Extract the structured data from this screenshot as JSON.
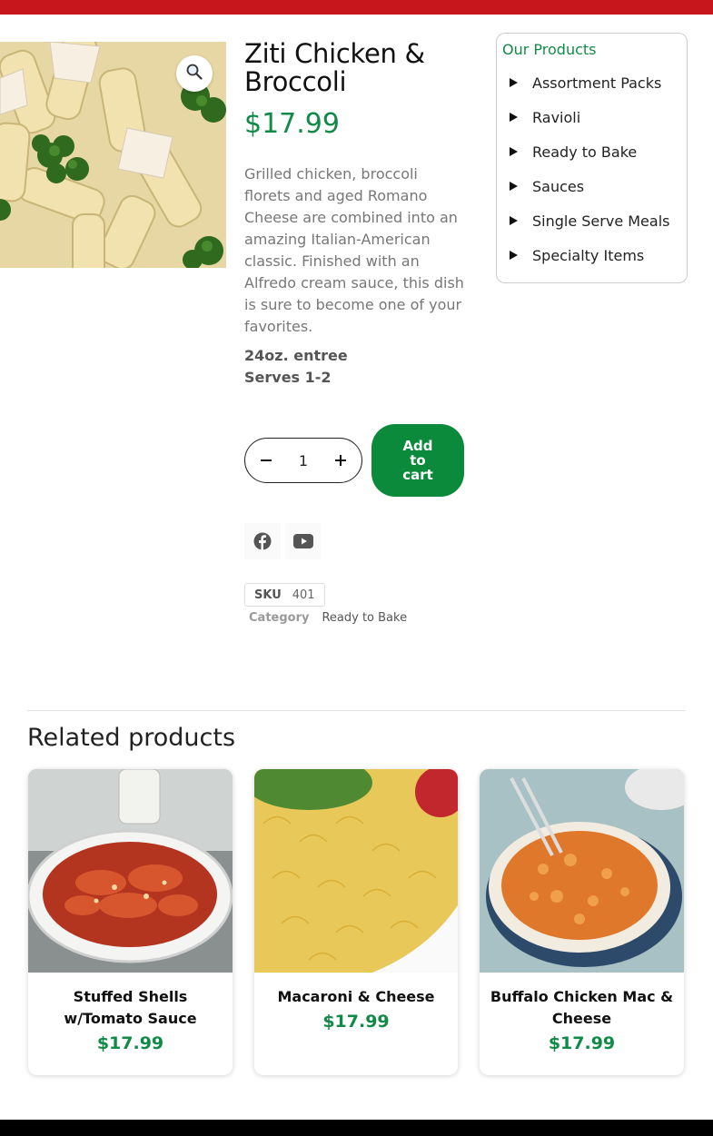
{
  "product": {
    "title": "Ziti Chicken & Broccoli",
    "price": "$17.99",
    "description": "Grilled chicken, broccoli florets and aged Romano Cheese are combined into an amazing Italian-American classic. Finished with an Alfredo cream sauce, this dish is sure to become one of your favorites.",
    "size": "24oz. entree",
    "serves": "Serves 1-2",
    "quantity": "1",
    "add_to_cart_label": "Add to cart",
    "sku_label": "SKU",
    "sku_value": "401",
    "category_label": "Category",
    "category_value": "Ready to Bake",
    "image_icon": "zoom-icon"
  },
  "social": {
    "items": [
      "facebook-icon",
      "youtube-icon"
    ]
  },
  "sidebar": {
    "title": "Our Products",
    "items": [
      {
        "label": "Assortment Packs"
      },
      {
        "label": "Ravioli"
      },
      {
        "label": "Ready to Bake"
      },
      {
        "label": "Sauces"
      },
      {
        "label": "Single Serve Meals"
      },
      {
        "label": "Specialty Items"
      }
    ]
  },
  "related": {
    "title": "Related products",
    "items": [
      {
        "name": "Stuffed Shells w/Tomato Sauce",
        "price": "$17.99"
      },
      {
        "name": "Macaroni & Cheese",
        "price": "$17.99"
      },
      {
        "name": "Buffalo Chicken Mac & Cheese",
        "price": "$17.99"
      }
    ]
  },
  "colors": {
    "accent_green": "#118a47",
    "button_green": "#0b8a3b",
    "header_red": "#c8161d"
  }
}
